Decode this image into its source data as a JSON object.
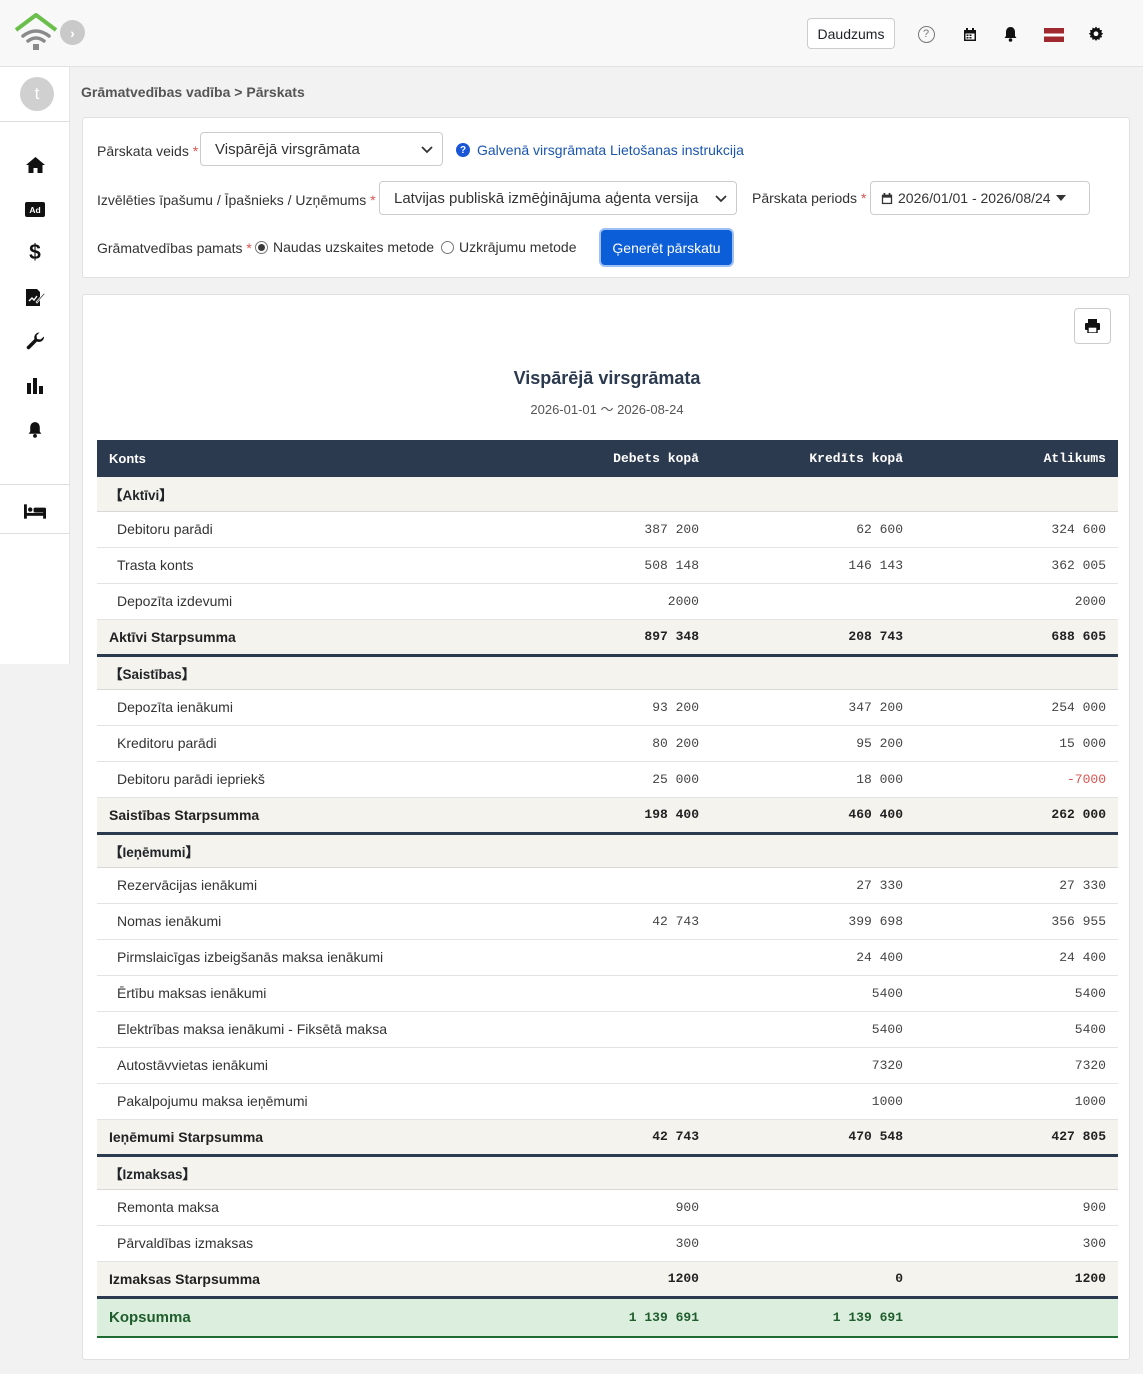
{
  "header": {
    "quantity_button": "Daudzums",
    "icons": [
      "help-icon",
      "calendar-icon",
      "bell-icon",
      "latvia-flag-icon",
      "gear-icon"
    ]
  },
  "sidebar": {
    "avatar_letter": "t",
    "icons": [
      "home-icon",
      "ad-icon",
      "dollar-icon",
      "contract-icon",
      "wrench-icon",
      "chart-icon",
      "bell-icon",
      "bed-icon"
    ]
  },
  "breadcrumb": "Grāmatvedības vadība > Pārskats",
  "filters": {
    "report_type_label": "Pārskata veids",
    "report_type_value": "Vispārējā virsgrāmata",
    "help_link": "Galvenā virsgrāmata Lietošanas instrukcija",
    "property_label": "Izvēlēties īpašumu / Īpašnieks / Uzņēmums",
    "property_value": "Latvijas publiskā izmēģinājuma aģenta versija",
    "period_label": "Pārskata periods",
    "period_value": "2026/01/01 - 2026/08/24",
    "basis_label": "Grāmatvedības pamats",
    "basis_cash": "Naudas uzskaites metode",
    "basis_accrual": "Uzkrājumu metode",
    "basis_selected": "cash",
    "required_mark": "*",
    "generate_button": "Ģenerēt pārskatu"
  },
  "report": {
    "title": "Vispārējā virsgrāmata",
    "range": "2026-01-01 〜 2026-08-24",
    "columns": [
      "Konts",
      "Debets kopā",
      "Kredīts kopā",
      "Atlikums"
    ],
    "sections": [
      {
        "name": "【Aktīvi】",
        "rows": [
          {
            "account": "Debitoru parādi",
            "debit": "387 200",
            "credit": "62 600",
            "balance": "324 600"
          },
          {
            "account": "Trasta konts",
            "debit": "508 148",
            "credit": "146 143",
            "balance": "362 005"
          },
          {
            "account": "Depozīta izdevumi",
            "debit": "2000",
            "credit": "",
            "balance": "2000"
          }
        ],
        "subtotal": {
          "label": "Aktīvi Starpsumma",
          "debit": "897 348",
          "credit": "208 743",
          "balance": "688 605"
        }
      },
      {
        "name": "【Saistības】",
        "rows": [
          {
            "account": "Depozīta ienākumi",
            "debit": "93 200",
            "credit": "347 200",
            "balance": "254 000"
          },
          {
            "account": "Kreditoru parādi",
            "debit": "80 200",
            "credit": "95 200",
            "balance": "15 000"
          },
          {
            "account": "Debitoru parādi iepriekš",
            "debit": "25 000",
            "credit": "18 000",
            "balance": "-7000"
          }
        ],
        "subtotal": {
          "label": "Saistības Starpsumma",
          "debit": "198 400",
          "credit": "460 400",
          "balance": "262 000"
        }
      },
      {
        "name": "【Ieņēmumi】",
        "rows": [
          {
            "account": "Rezervācijas ienākumi",
            "debit": "",
            "credit": "27 330",
            "balance": "27 330"
          },
          {
            "account": "Nomas ienākumi",
            "debit": "42 743",
            "credit": "399 698",
            "balance": "356 955"
          },
          {
            "account": "Pirmslaicīgas izbeigšanās maksa ienākumi",
            "debit": "",
            "credit": "24 400",
            "balance": "24 400"
          },
          {
            "account": "Ērtību maksas ienākumi",
            "debit": "",
            "credit": "5400",
            "balance": "5400"
          },
          {
            "account": "Elektrības maksa ienākumi - Fiksētā maksa",
            "debit": "",
            "credit": "5400",
            "balance": "5400"
          },
          {
            "account": "Autostāvvietas ienākumi",
            "debit": "",
            "credit": "7320",
            "balance": "7320"
          },
          {
            "account": "Pakalpojumu maksa ieņēmumi",
            "debit": "",
            "credit": "1000",
            "balance": "1000"
          }
        ],
        "subtotal": {
          "label": "Ieņēmumi Starpsumma",
          "debit": "42 743",
          "credit": "470 548",
          "balance": "427 805"
        }
      },
      {
        "name": "【Izmaksas】",
        "rows": [
          {
            "account": "Remonta maksa",
            "debit": "900",
            "credit": "",
            "balance": "900"
          },
          {
            "account": "Pārvaldības izmaksas",
            "debit": "300",
            "credit": "",
            "balance": "300"
          }
        ],
        "subtotal": {
          "label": "Izmaksas Starpsumma",
          "debit": "1200",
          "credit": "0",
          "balance": "1200"
        }
      }
    ],
    "total": {
      "label": "Kopsumma",
      "debit": "1 139 691",
      "credit": "1 139 691",
      "balance": ""
    }
  },
  "colors": {
    "header_navy": "#2b3a4f",
    "primary_blue": "#0b5ed7",
    "negative_red": "#d9534f",
    "total_green_bg": "#dcefdf",
    "section_beige": "#f4f3ed"
  }
}
